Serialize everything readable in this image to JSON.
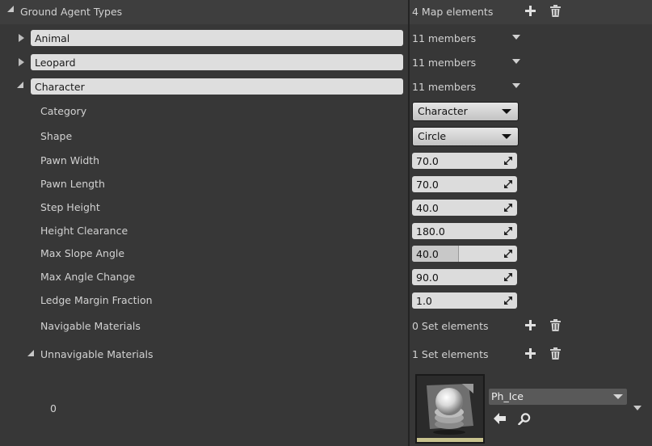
{
  "header": {
    "title": "Ground Agent Types",
    "elements_count": "4 Map elements",
    "add_icon": "plus-icon",
    "delete_icon": "trash-icon"
  },
  "map_entries": [
    {
      "key": "Animal",
      "members": "11 members",
      "expanded": false
    },
    {
      "key": "Leopard",
      "members": "11 members",
      "expanded": false
    },
    {
      "key": "Character",
      "members": "11 members",
      "expanded": true
    }
  ],
  "properties": {
    "category": {
      "label": "Category",
      "value": "Character"
    },
    "shape": {
      "label": "Shape",
      "value": "Circle"
    },
    "pawn_width": {
      "label": "Pawn Width",
      "value": "70.0"
    },
    "pawn_length": {
      "label": "Pawn Length",
      "value": "70.0"
    },
    "step_height": {
      "label": "Step Height",
      "value": "40.0"
    },
    "height_clearance": {
      "label": "Height Clearance",
      "value": "180.0"
    },
    "max_slope_angle": {
      "label": "Max Slope Angle",
      "value": "40.0",
      "slider_fraction": 0.44
    },
    "max_angle_change": {
      "label": "Max Angle Change",
      "value": "90.0"
    },
    "ledge_margin_fraction": {
      "label": "Ledge Margin Fraction",
      "value": "1.0"
    }
  },
  "navigable_materials": {
    "label": "Navigable Materials",
    "count": "0 Set elements"
  },
  "unnavigable_materials": {
    "label": "Unnavigable Materials",
    "count": "1 Set elements",
    "items": [
      {
        "index": "0",
        "asset": "Ph_Ice"
      }
    ]
  },
  "colors": {
    "background": "#373737",
    "header": "#3e3e3e",
    "thumbnail_accent": "#c9c48f"
  }
}
